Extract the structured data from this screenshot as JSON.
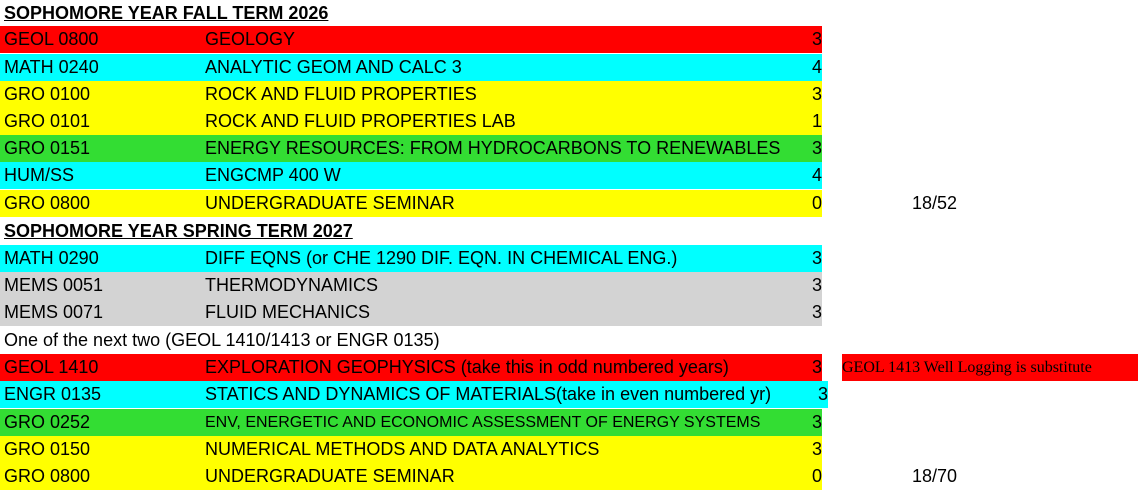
{
  "colors": {
    "red": "#ff0000",
    "cyan": "#00ffff",
    "yellow": "#ffff00",
    "green": "#33dd33",
    "gray": "#d3d3d3"
  },
  "fall": {
    "heading": "SOPHOMORE YEAR FALL TERM 2026",
    "courses": [
      {
        "code": "GEOL 0800",
        "title": "GEOLOGY",
        "credits": "3",
        "color": "#ff0000"
      },
      {
        "code": "MATH 0240",
        "title": "ANALYTIC GEOM AND CALC 3",
        "credits": "4",
        "color": "#00ffff"
      },
      {
        "code": "GRO 0100",
        "title": "ROCK AND FLUID PROPERTIES",
        "credits": "3",
        "color": "#ffff00"
      },
      {
        "code": "GRO 0101",
        "title": "ROCK AND FLUID PROPERTIES LAB",
        "credits": "1",
        "color": "#ffff00"
      },
      {
        "code": "GRO 0151",
        "title": "ENERGY RESOURCES: FROM HYDROCARBONS TO RENEWABLES",
        "credits": "3",
        "color": "#33dd33"
      },
      {
        "code": "HUM/SS",
        "title": "ENGCMP 400 W",
        "credits": "4",
        "color": "#00ffff"
      },
      {
        "code": "GRO 0800",
        "title": "UNDERGRADUATE SEMINAR",
        "credits": "0",
        "color": "#ffff00"
      }
    ],
    "total": "18/52"
  },
  "spring": {
    "heading": "SOPHOMORE YEAR SPRING TERM 2027",
    "courses_a": [
      {
        "code": "MATH 0290",
        "title": "DIFF EQNS (or CHE 1290 DIF. EQN. IN CHEMICAL ENG.)",
        "credits": "3",
        "color": "#00ffff"
      },
      {
        "code": "MEMS 0051",
        "title": "THERMODYNAMICS",
        "credits": "3",
        "color": "#d3d3d3"
      },
      {
        "code": "MEMS 0071",
        "title": "FLUID MECHANICS",
        "credits": "3",
        "color": "#d3d3d3"
      }
    ],
    "choice_note": "One of the next two (GEOL 1410/1413 or ENGR 0135)",
    "courses_b": [
      {
        "code": "GEOL 1410",
        "title": "EXPLORATION GEOPHYSICS  (take this in odd numbered years)",
        "credits": "3",
        "color": "#ff0000"
      },
      {
        "code": "ENGR 0135",
        "title": "STATICS AND DYNAMICS OF MATERIALS(take in even numbered yr)",
        "credits": "3",
        "color": "#00ffff"
      },
      {
        "code": "GRO 0252",
        "title": "ENV, ENERGETIC AND ECONOMIC ASSESSMENT OF ENERGY SYSTEMS",
        "credits": "3",
        "color": "#33dd33"
      },
      {
        "code": "GRO 0150",
        "title": "NUMERICAL METHODS AND DATA ANALYTICS",
        "credits": "3",
        "color": "#ffff00"
      },
      {
        "code": "GRO 0800",
        "title": "UNDERGRADUATE SEMINAR",
        "credits": "0",
        "color": "#ffff00"
      }
    ],
    "substitute_note": "GEOL 1413 Well Logging is substitute",
    "total": "18/70"
  }
}
